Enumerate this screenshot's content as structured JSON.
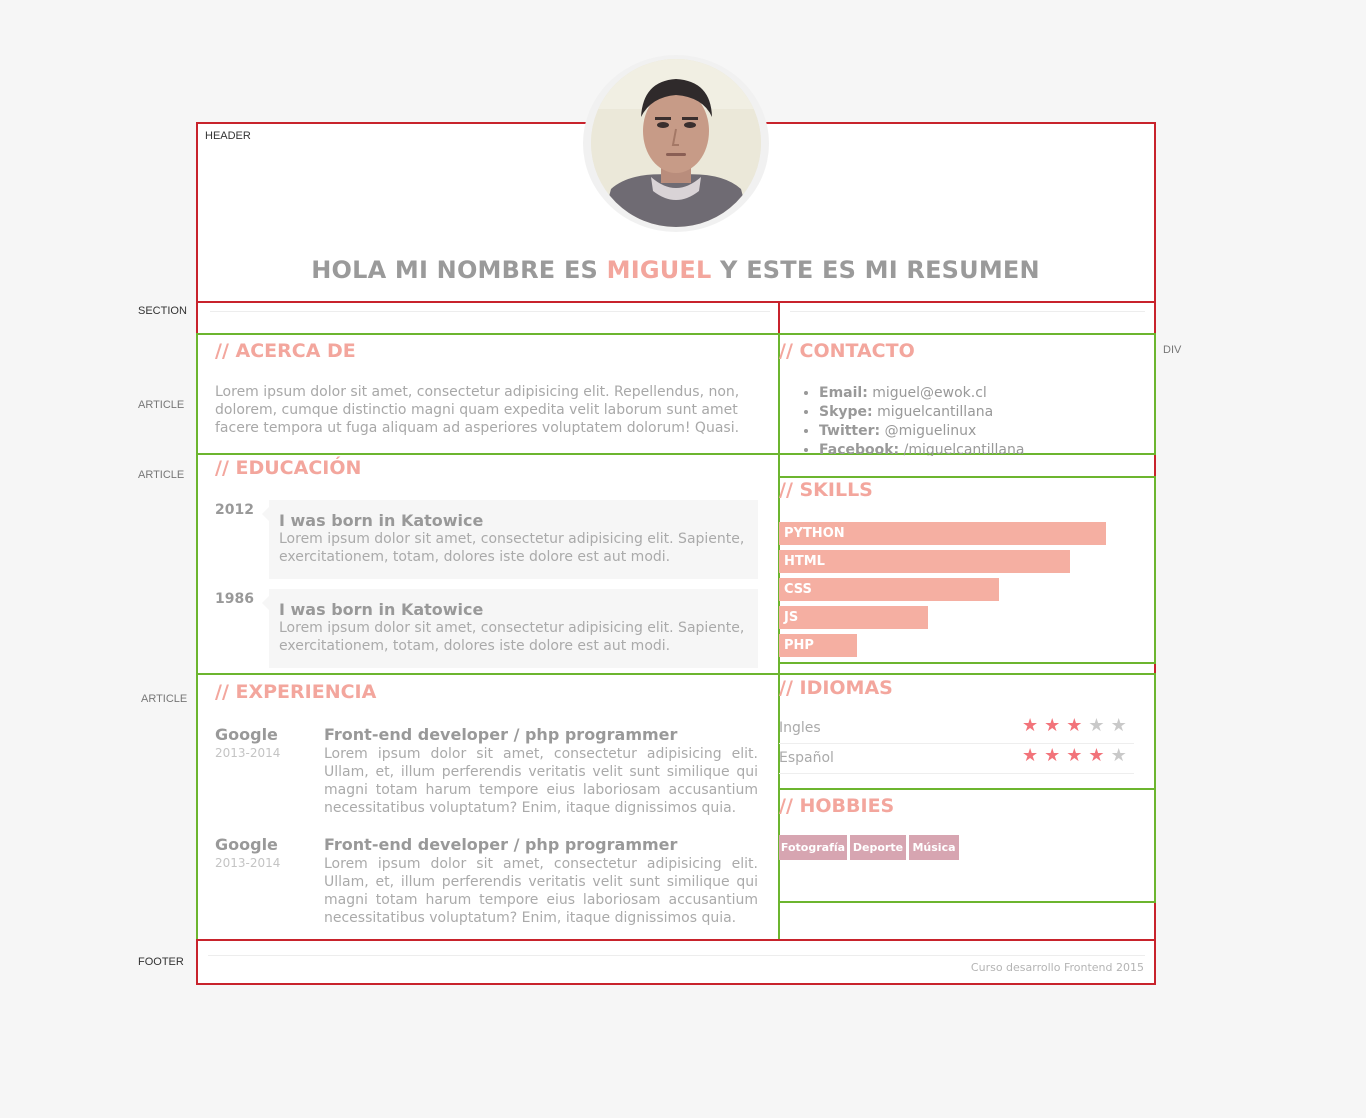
{
  "labels": {
    "header": "HEADER",
    "section": "SECTION",
    "article1": "ARTICLE",
    "article2": "ARTICLE",
    "article3": "ARTICLE",
    "div": "DIV",
    "footer": "FOOTER"
  },
  "header": {
    "title_pre": "HOLA MI NOMBRE ES ",
    "title_name": "MIGUEL",
    "title_post": " Y ESTE ES MI RESUMEN"
  },
  "about": {
    "heading": "// ACERCA DE",
    "text": "Lorem ipsum dolor sit amet, consectetur adipisicing elit. Repellendus, non, dolorem, cumque distinctio magni quam expedita velit laborum sunt amet facere tempora ut fuga aliquam ad asperiores voluptatem dolorum! Quasi."
  },
  "education": {
    "heading": "// EDUCACIÓN",
    "items": [
      {
        "year": "2012",
        "title": "I was born in Katowice",
        "text": "Lorem ipsum dolor sit amet, consectetur adipisicing elit. Sapiente, exercitationem, totam, dolores iste dolore est aut modi."
      },
      {
        "year": "1986",
        "title": "I was born in Katowice",
        "text": "Lorem ipsum dolor sit amet, consectetur adipisicing elit. Sapiente, exercitationem, totam, dolores iste dolore est aut modi."
      }
    ]
  },
  "experience": {
    "heading": "// EXPERIENCIA",
    "items": [
      {
        "company": "Google",
        "years": "2013-2014",
        "role": "Front-end developer / php programmer",
        "text": "Lorem ipsum dolor sit amet, consectetur adipisicing elit. Ullam, et, illum perferendis veritatis velit sunt similique qui magni totam harum tempore eius laboriosam accusantium necessitatibus voluptatum? Enim, itaque dignissimos quia."
      },
      {
        "company": "Google",
        "years": "2013-2014",
        "role": "Front-end developer / php programmer",
        "text": "Lorem ipsum dolor sit amet, consectetur adipisicing elit. Ullam, et, illum perferendis veritatis velit sunt similique qui magni totam harum tempore eius laboriosam accusantium necessitatibus voluptatum? Enim, itaque dignissimos quia."
      }
    ]
  },
  "contact": {
    "heading": "// CONTACTO",
    "items": [
      {
        "label": "Email:",
        "value": "miguel@ewok.cl"
      },
      {
        "label": "Skype:",
        "value": "miguelcantillana"
      },
      {
        "label": "Twitter:",
        "value": "@miguelinux"
      },
      {
        "label": "Facebook:",
        "value": "/miguelcantillana"
      }
    ]
  },
  "skills": {
    "heading": "// SKILLS",
    "items": [
      {
        "name": "PYTHON",
        "level": 0.92
      },
      {
        "name": "HTML",
        "level": 0.82
      },
      {
        "name": "CSS",
        "level": 0.62
      },
      {
        "name": "JS",
        "level": 0.42
      },
      {
        "name": "PHP",
        "level": 0.22
      }
    ]
  },
  "languages": {
    "heading": "// IDIOMAS",
    "items": [
      {
        "name": "Ingles",
        "stars": 3,
        "max": 5
      },
      {
        "name": "Español",
        "stars": 4,
        "max": 5
      }
    ]
  },
  "hobbies": {
    "heading": "// HOBBIES",
    "tags": [
      "Fotografía",
      "Deporte",
      "Música"
    ]
  },
  "footer": {
    "text": "Curso desarrollo Frontend 2015"
  },
  "colors": {
    "accent": "#f3a69d",
    "star_on": "#f2737a",
    "outline_red": "#c8232c",
    "outline_green": "#6cb52f",
    "tag": "#d7a5b1"
  }
}
